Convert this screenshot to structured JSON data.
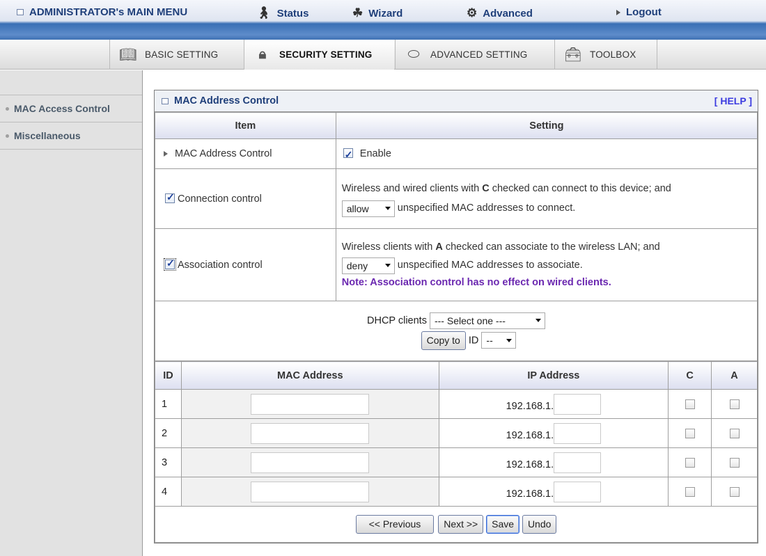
{
  "topmenu": {
    "main_menu": "ADMINISTRATOR's MAIN MENU",
    "status": "Status",
    "wizard": "Wizard",
    "advanced": "Advanced",
    "logout": "Logout"
  },
  "tabs": [
    {
      "label": "BASIC SETTING",
      "icon": "book-icon"
    },
    {
      "label": "SECURITY SETTING",
      "icon": "lock-icon",
      "active": true
    },
    {
      "label": "ADVANCED SETTING",
      "icon": "router-icon"
    },
    {
      "label": "TOOLBOX",
      "icon": "toolbox-icon"
    }
  ],
  "sidebar": {
    "items": [
      {
        "label": "MAC Access Control"
      },
      {
        "label": "Miscellaneous"
      }
    ]
  },
  "panel": {
    "title": "MAC Address Control",
    "help": "[ HELP ]",
    "col_item": "Item",
    "col_setting": "Setting",
    "mac_control_label": "MAC Address Control",
    "enable_label": "Enable",
    "enable_checked": true,
    "connection": {
      "label": "Connection control",
      "checked": true,
      "text_pre": "Wireless and wired clients with ",
      "text_bold": "C",
      "text_post": " checked can connect to this device; and",
      "select_value": "allow",
      "select_suffix": "unspecified MAC addresses to connect."
    },
    "association": {
      "label": "Association control",
      "checked": true,
      "text_pre": "Wireless clients with ",
      "text_bold": "A",
      "text_post": " checked can associate to the wireless LAN; and",
      "select_value": "deny",
      "select_suffix": "unspecified MAC addresses to associate.",
      "note": "Note: Association control has no effect on wired clients."
    },
    "dhcp": {
      "label": "DHCP clients",
      "select_value": "--- Select one ---",
      "copy_button": "Copy to",
      "id_label": "ID",
      "id_value": "--"
    },
    "table": {
      "headers": {
        "id": "ID",
        "mac": "MAC Address",
        "ip": "IP Address",
        "c": "C",
        "a": "A"
      },
      "ip_prefix": "192.168.1.",
      "rows": [
        {
          "id": "1",
          "mac": "",
          "ip_suffix": "",
          "c": false,
          "a": false
        },
        {
          "id": "2",
          "mac": "",
          "ip_suffix": "",
          "c": false,
          "a": false
        },
        {
          "id": "3",
          "mac": "",
          "ip_suffix": "",
          "c": false,
          "a": false
        },
        {
          "id": "4",
          "mac": "",
          "ip_suffix": "",
          "c": false,
          "a": false
        }
      ]
    },
    "buttons": {
      "previous": "<< Previous",
      "next": "Next >>",
      "save": "Save",
      "undo": "Undo"
    }
  }
}
